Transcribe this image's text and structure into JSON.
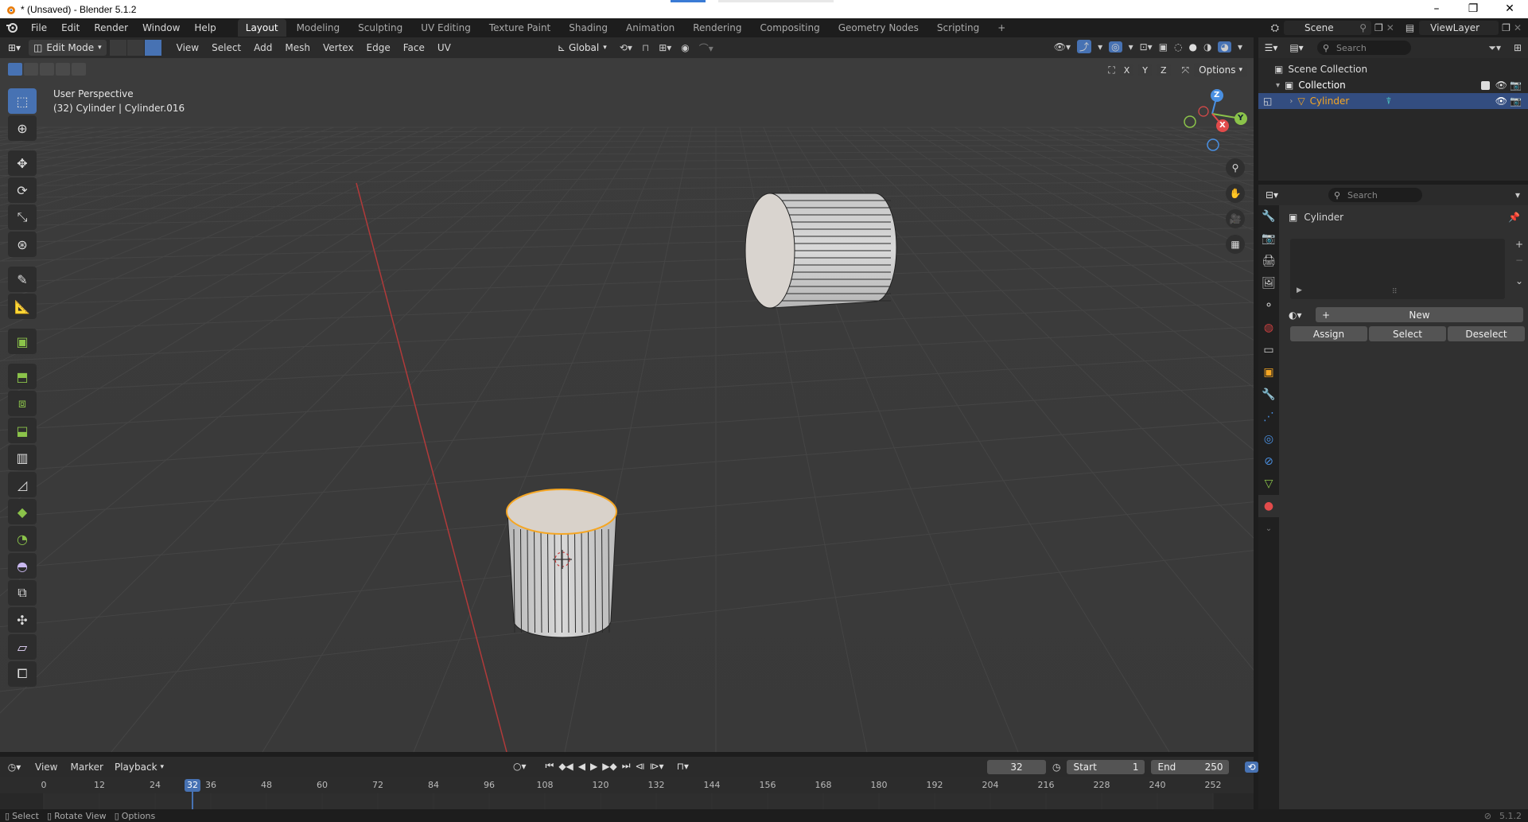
{
  "window": {
    "title": "* (Unsaved) - Blender 5.1.2",
    "controls": [
      "–",
      "❐",
      "✕"
    ]
  },
  "topbar": {
    "menus": [
      "File",
      "Edit",
      "Render",
      "Window",
      "Help"
    ],
    "workspaces": [
      "Layout",
      "Modeling",
      "Sculpting",
      "UV Editing",
      "Texture Paint",
      "Shading",
      "Animation",
      "Rendering",
      "Compositing",
      "Geometry Nodes",
      "Scripting"
    ],
    "active_workspace": "Layout",
    "add_workspace": "+",
    "scene": "Scene",
    "view_layer": "ViewLayer"
  },
  "viewport_header": {
    "mode": "Edit Mode",
    "menus": [
      "View",
      "Select",
      "Add",
      "Mesh",
      "Vertex",
      "Edge",
      "Face",
      "UV"
    ],
    "orientation": "Global",
    "options_label": "Options",
    "axis_x": "X",
    "axis_y": "Y",
    "axis_z": "Z"
  },
  "viewport": {
    "perspective": "User Perspective",
    "object_info": "(32) Cylinder | Cylinder.016",
    "gizmo": {
      "x": "X",
      "y": "Y",
      "z": "Z"
    }
  },
  "timeline": {
    "menus": [
      "View",
      "Marker",
      "Playback"
    ],
    "current_frame": "32",
    "start_label": "Start",
    "start_value": "1",
    "end_label": "End",
    "end_value": "250",
    "ticks": [
      "0",
      "12",
      "24",
      "36",
      "48",
      "60",
      "72",
      "84",
      "96",
      "108",
      "120",
      "132",
      "144",
      "156",
      "168",
      "180",
      "192",
      "204",
      "216",
      "228",
      "240",
      "252"
    ],
    "playhead": "32"
  },
  "outliner": {
    "search_placeholder": "Search",
    "scene_collection": "Scene Collection",
    "collection": "Collection",
    "object": "Cylinder"
  },
  "properties": {
    "search_placeholder": "Search",
    "object_name": "Cylinder",
    "new_label": "New",
    "assign_label": "Assign",
    "select_label": "Select",
    "deselect_label": "Deselect"
  },
  "statusbar": {
    "select": "Select",
    "rotate": "Rotate View",
    "options": "Options",
    "version": "5.1.2"
  },
  "colors": {
    "accent_blue": "#4772b3",
    "selection_orange": "#f5a623",
    "x_axis": "#e24b4b",
    "y_axis": "#8bc34a",
    "z_axis": "#4a90e2"
  }
}
